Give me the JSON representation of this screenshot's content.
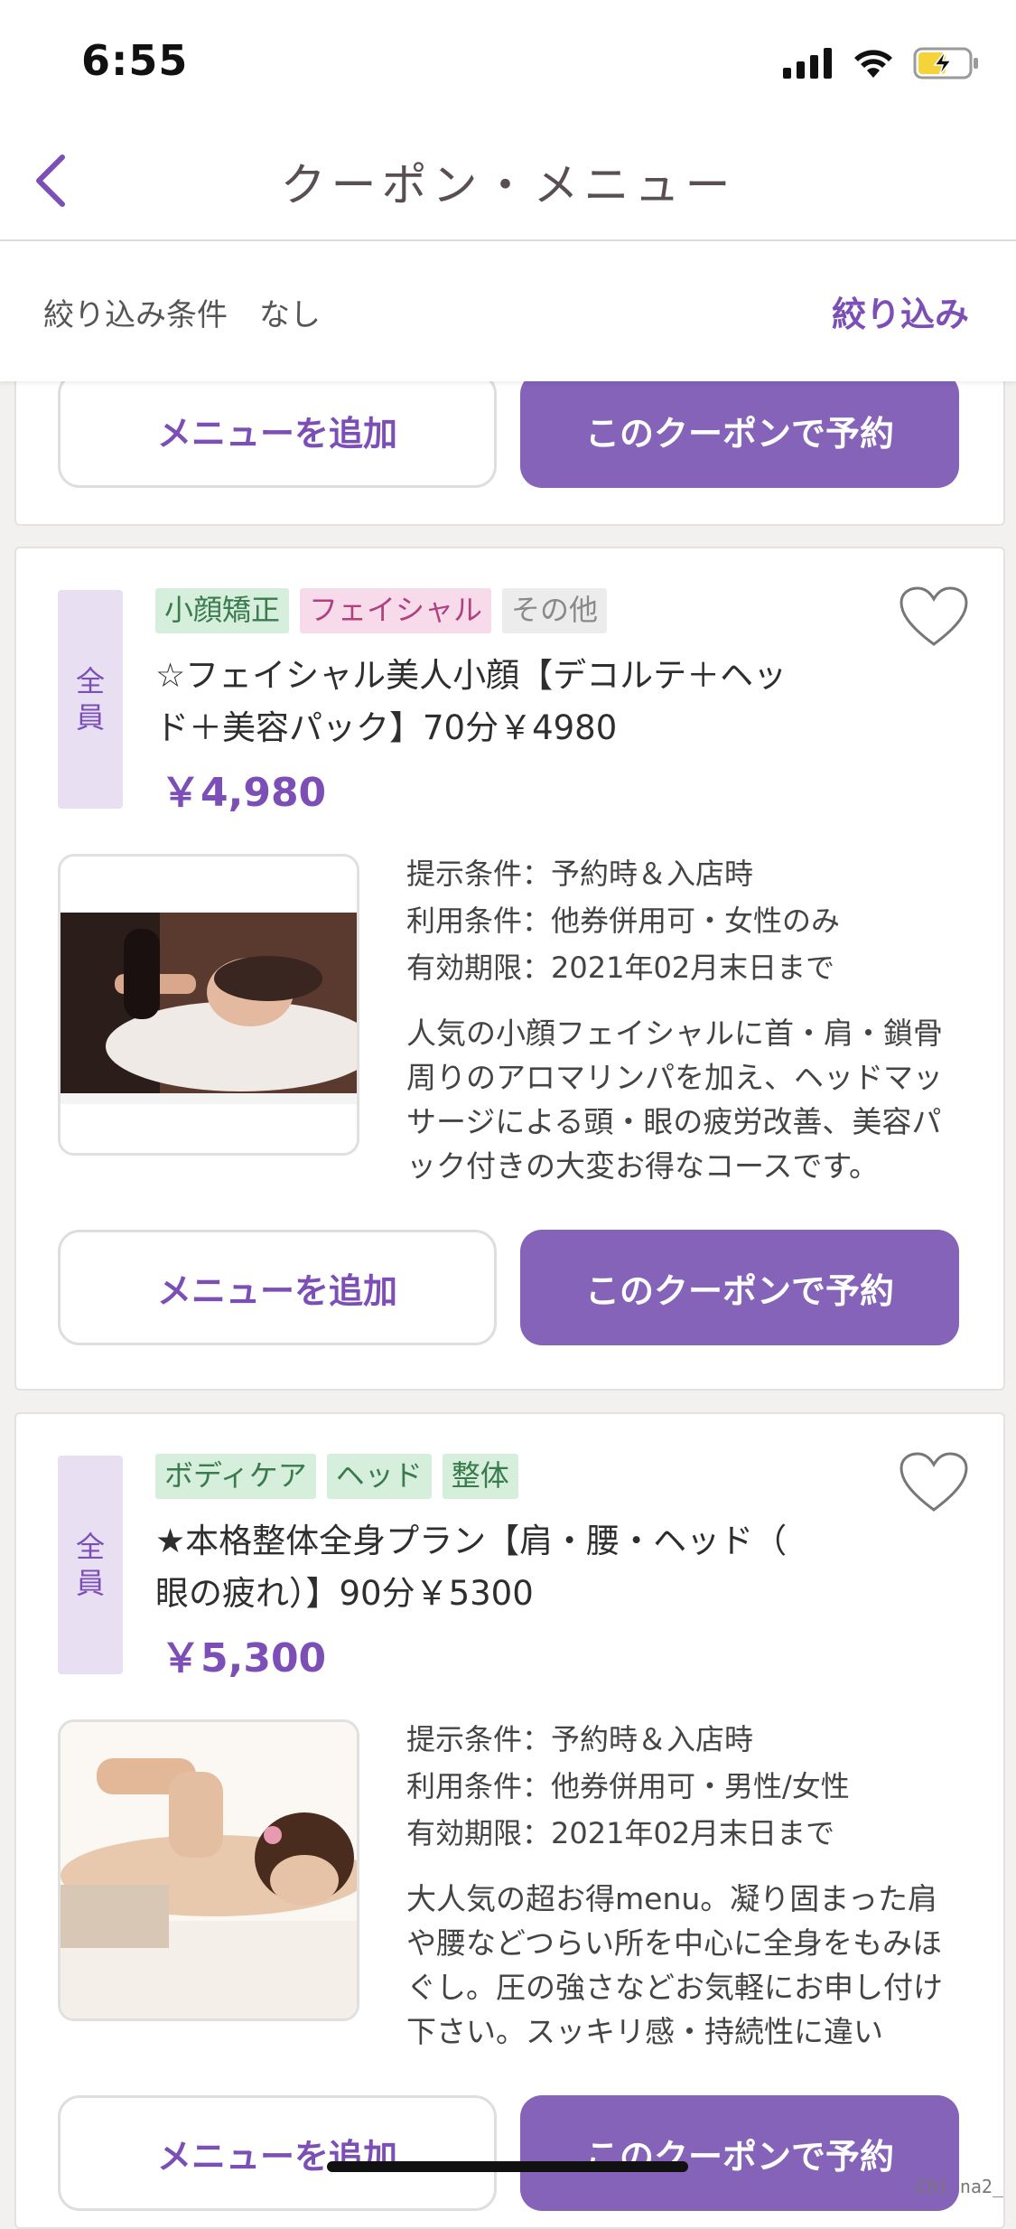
{
  "status": {
    "time": "6:55"
  },
  "nav": {
    "title": "クーポン・メニュー"
  },
  "filter": {
    "label": "絞り込み条件",
    "value": "なし",
    "action": "絞り込み"
  },
  "buttons": {
    "add_menu": "メニューを追加",
    "book_coupon": "このクーポンで予約"
  },
  "cards": [
    {
      "badge": [
        "全",
        "員"
      ],
      "tags": [
        {
          "label": "小顔矯正",
          "color": "green"
        },
        {
          "label": "フェイシャル",
          "color": "pink"
        },
        {
          "label": "その他",
          "color": "gray"
        }
      ],
      "title_lines": [
        "☆フェイシャル美人小顔【デコルテ＋ヘッ",
        "ド＋美容パック】70分￥4980"
      ],
      "price": "￥4,980",
      "conditions": [
        "提示条件：予約時＆入店時",
        "利用条件：他券併用可・女性のみ",
        "有効期限：2021年02月末日まで"
      ],
      "description": [
        "人気の小顔フェイシャルに首・肩・鎖骨",
        "周りのアロマリンパを加え、ヘッドマッ",
        "サージによる頭・眼の疲労改善、美容パ",
        "ック付きの大変お得なコースです。"
      ]
    },
    {
      "badge": [
        "全",
        "員"
      ],
      "tags": [
        {
          "label": "ボディケア",
          "color": "green"
        },
        {
          "label": "ヘッド",
          "color": "green"
        },
        {
          "label": "整体",
          "color": "green"
        }
      ],
      "title_lines": [
        "★本格整体全身プラン【肩・腰・ヘッド（",
        "眼の疲れ）】90分￥5300"
      ],
      "price": "￥5,300",
      "conditions": [
        "提示条件：予約時＆入店時",
        "利用条件：他券併用可・男性/女性",
        "有効期限：2021年02月末日まで"
      ],
      "description": [
        "大人気の超お得menu。凝り固まった肩",
        "や腰などつらい所を中心に全身をもみほ",
        "ぐし。圧の強さなどお気軽にお申し付け",
        "下さい。スッキリ感・持続性に違い"
      ]
    }
  ],
  "colors": {
    "accent": "#7b4fb6",
    "primary_button": "#8563b8"
  },
  "watermark": "Chi na2_"
}
